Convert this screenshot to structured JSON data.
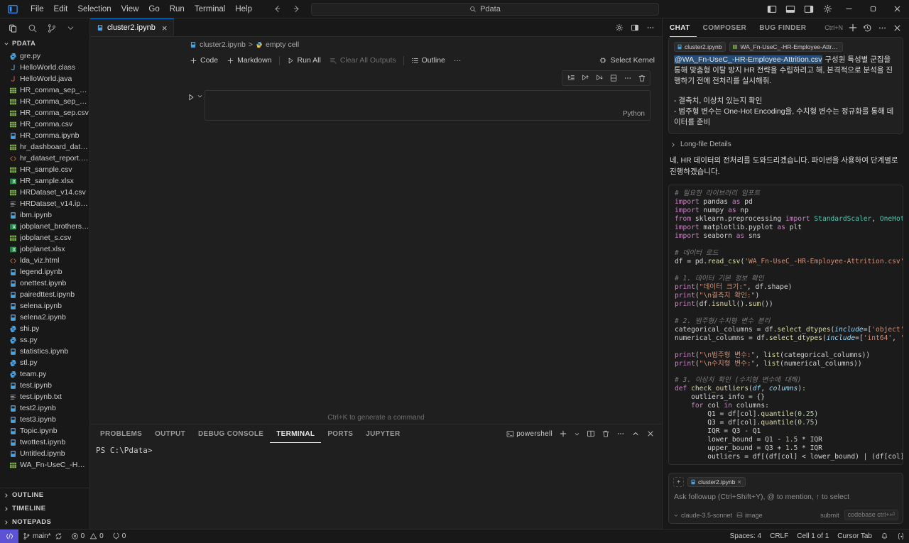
{
  "titlebar": {
    "menus": [
      "File",
      "Edit",
      "Selection",
      "View",
      "Go",
      "Run",
      "Terminal",
      "Help"
    ],
    "search_text": "Pdata",
    "back_icon": "arrow-left-icon",
    "forward_icon": "arrow-right-icon"
  },
  "sidebar": {
    "section_title": "PDATA",
    "top_icons": [
      "explorer-icon",
      "search-icon",
      "source-control-icon",
      "chevron-down-icon"
    ],
    "files": [
      {
        "name": "gre.py",
        "type": "py"
      },
      {
        "name": "HelloWorld.class",
        "type": "class"
      },
      {
        "name": "HelloWorld.java",
        "type": "java"
      },
      {
        "name": "HR_comma_sep_capp...",
        "type": "csv"
      },
      {
        "name": "HR_comma_sep_clean...",
        "type": "csv"
      },
      {
        "name": "HR_comma_sep.csv",
        "type": "csv"
      },
      {
        "name": "HR_comma.csv",
        "type": "csv"
      },
      {
        "name": "HR_comma.ipynb",
        "type": "ipynb"
      },
      {
        "name": "hr_dashboard_data.csv",
        "type": "csv"
      },
      {
        "name": "hr_dataset_report.html",
        "type": "html"
      },
      {
        "name": "HR_sample.csv",
        "type": "csv"
      },
      {
        "name": "HR_sample.xlsx",
        "type": "xlsx"
      },
      {
        "name": "HRDataset_v14.csv",
        "type": "csv"
      },
      {
        "name": "HRDataset_v14.ipynb....",
        "type": "txt"
      },
      {
        "name": "ibm.ipynb",
        "type": "ipynb"
      },
      {
        "name": "jobplanet_brothers.xlsx",
        "type": "xlsx"
      },
      {
        "name": "jobplanet_s.csv",
        "type": "csv"
      },
      {
        "name": "jobplanet.xlsx",
        "type": "xlsx"
      },
      {
        "name": "lda_viz.html",
        "type": "html"
      },
      {
        "name": "legend.ipynb",
        "type": "ipynb"
      },
      {
        "name": "onettest.ipynb",
        "type": "ipynb"
      },
      {
        "name": "pairedttest.ipynb",
        "type": "ipynb"
      },
      {
        "name": "selena.ipynb",
        "type": "ipynb"
      },
      {
        "name": "selena2.ipynb",
        "type": "ipynb"
      },
      {
        "name": "shi.py",
        "type": "py"
      },
      {
        "name": "ss.py",
        "type": "py"
      },
      {
        "name": "statistics.ipynb",
        "type": "ipynb"
      },
      {
        "name": "stl.py",
        "type": "py"
      },
      {
        "name": "team.py",
        "type": "py"
      },
      {
        "name": "test.ipynb",
        "type": "ipynb"
      },
      {
        "name": "test.ipynb.txt",
        "type": "txt"
      },
      {
        "name": "test2.ipynb",
        "type": "ipynb"
      },
      {
        "name": "test3.ipynb",
        "type": "ipynb"
      },
      {
        "name": "Topic.ipynb",
        "type": "ipynb"
      },
      {
        "name": "twottest.ipynb",
        "type": "ipynb"
      },
      {
        "name": "Untitled.ipynb",
        "type": "ipynb"
      },
      {
        "name": "WA_Fn-UseC_-HR-Em...",
        "type": "csv"
      }
    ],
    "bottom_sections": [
      "OUTLINE",
      "TIMELINE",
      "NOTEPADS"
    ]
  },
  "editor": {
    "tab_label": "cluster2.ipynb",
    "breadcrumb_file": "cluster2.ipynb",
    "breadcrumb_sep": ">",
    "breadcrumb_cell": "empty cell",
    "toolbar": {
      "code": "Code",
      "markdown": "Markdown",
      "run_all": "Run All",
      "clear_all_outputs": "Clear All Outputs",
      "outline": "Outline",
      "more": "···",
      "select_kernel": "Select Kernel"
    },
    "cell_language": "Python",
    "ctrl_k_hint": "Ctrl+K to generate a command"
  },
  "panel": {
    "tabs": [
      "PROBLEMS",
      "OUTPUT",
      "DEBUG CONSOLE",
      "TERMINAL",
      "PORTS",
      "JUPYTER"
    ],
    "active_tab": "TERMINAL",
    "shell_label": "powershell",
    "terminal_line": "PS C:\\Pdata>"
  },
  "chat": {
    "tabs": [
      "CHAT",
      "COMPOSER",
      "BUG FINDER"
    ],
    "active_tab": "CHAT",
    "new_chat_hint": "Ctrl+N",
    "user_message": {
      "chips": [
        "cluster2.ipynb",
        "WA_Fn-UseC_-HR-Employee-Attrit..."
      ],
      "mention": "@WA_Fn-UseC_-HR-Employee-Attrition.csv",
      "body": " 구성원 특성별 군집을 통해 맞춤형 이탈 방지 HR 전략을 수립하려고 해, 본격적으로 분석을 진행하기 전에 전처리를 실시해줘.",
      "bullet1": "- 결측치, 이상치 있는지 확인",
      "bullet2": "- 범주형 변수는 One-Hot Encoding을, 수치형 변수는 정규화를 통해 데이터를 준비"
    },
    "long_file_details": "Long-file Details",
    "assistant_intro": "네, HR 데이터의 전처리를 도와드리겠습니다. 파이썬을 사용하여 단계별로 진행하겠습니다.",
    "input": {
      "chip": "cluster2.ipynb",
      "placeholder": "Ask followup (Ctrl+Shift+Y), @ to mention, ↑ to select",
      "model": "claude-3.5-sonnet",
      "image_label": "image",
      "submit_label": "submit",
      "codebase_label": "codebase ctrl+⏎"
    }
  },
  "statusbar": {
    "branch": "main*",
    "errors": "0",
    "warnings": "0",
    "ports": "0",
    "spaces": "Spaces: 4",
    "eol": "CRLF",
    "cell": "Cell 1 of 1",
    "cursor": "Cursor Tab"
  },
  "colors": {
    "accent": "#0078d4",
    "remote_badge": "#5c52d5",
    "csv_green": "#89c34c",
    "ipynb_blue": "#4aa3df",
    "py_blue": "#4aa3df",
    "html_orange": "#e8672a",
    "xlsx_green": "#37a05d",
    "java_red": "#d45050",
    "mention_bg": "#264f78"
  }
}
